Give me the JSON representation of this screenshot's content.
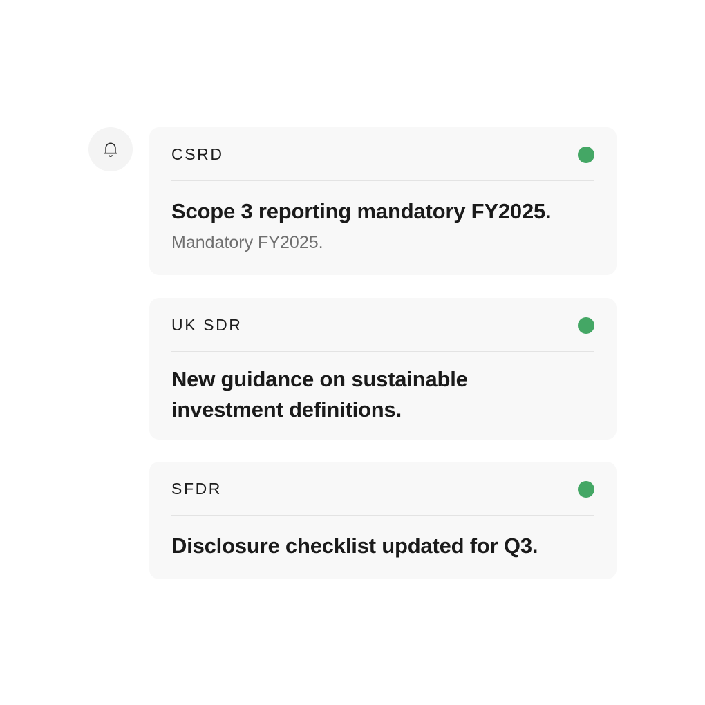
{
  "bell": {
    "icon": "bell-icon"
  },
  "notifications": [
    {
      "tag": "CSRD",
      "title": "Scope 3 reporting mandatory FY2025.",
      "subtitle": "Mandatory FY2025.",
      "status_color": "#44a765"
    },
    {
      "tag": "UK SDR",
      "title": "New guidance on sustainable investment definitions.",
      "status_color": "#44a765"
    },
    {
      "tag": "SFDR",
      "title": "Disclosure checklist updated for Q3.",
      "status_color": "#44a765"
    }
  ]
}
